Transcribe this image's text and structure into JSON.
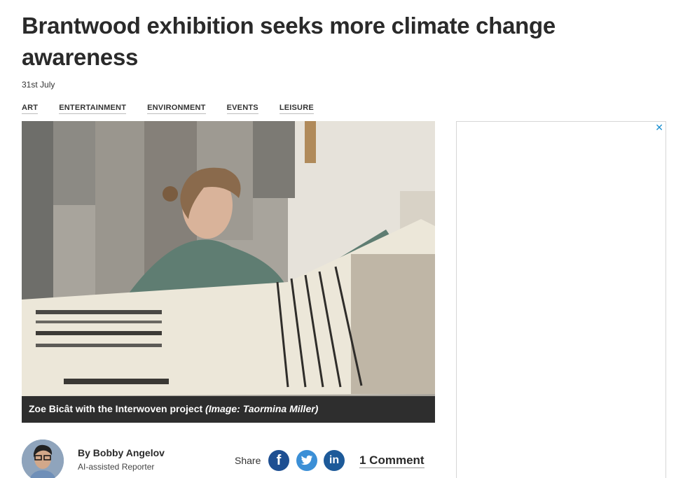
{
  "article": {
    "title": "Brantwood exhibition seeks more climate change awareness",
    "date": "31st July",
    "tags": [
      "ART",
      "ENTERTAINMENT",
      "ENVIRONMENT",
      "EVENTS",
      "LEISURE"
    ]
  },
  "image": {
    "caption": "Zoe Bicât with the Interwoven project",
    "credit": "(Image: Taormina Miller)"
  },
  "ad": {
    "close_glyph": "✕"
  },
  "byline": {
    "author": "By Bobby Angelov",
    "role": "AI-assisted Reporter",
    "share_label": "Share",
    "facebook_glyph": "f",
    "linkedin_glyph": "in",
    "comments_label": "1 Comment"
  }
}
